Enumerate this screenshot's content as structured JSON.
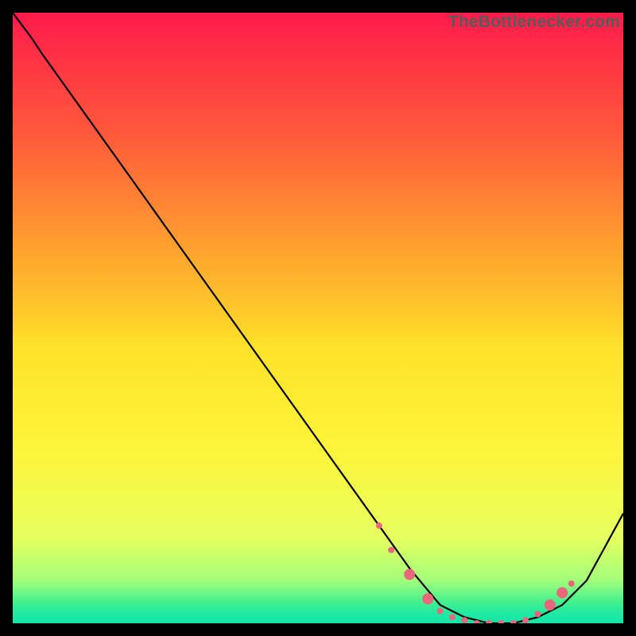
{
  "watermark": "TheBottlenecker.com",
  "chart_data": {
    "type": "line",
    "title": "",
    "xlabel": "",
    "ylabel": "",
    "xlim": [
      0,
      100
    ],
    "ylim": [
      0,
      100
    ],
    "grid": false,
    "legend": false,
    "background_gradient": {
      "stops": [
        {
          "pos": 0.0,
          "color": "#ff1a4b"
        },
        {
          "pos": 0.2,
          "color": "#ff5a3b"
        },
        {
          "pos": 0.4,
          "color": "#ffa62d"
        },
        {
          "pos": 0.55,
          "color": "#ffe22a"
        },
        {
          "pos": 0.72,
          "color": "#fdf53a"
        },
        {
          "pos": 0.86,
          "color": "#e6ff60"
        },
        {
          "pos": 0.93,
          "color": "#a2ff7a"
        },
        {
          "pos": 0.965,
          "color": "#44f08e"
        },
        {
          "pos": 0.985,
          "color": "#1de9a3"
        },
        {
          "pos": 1.0,
          "color": "#12e6a8"
        }
      ]
    },
    "series": [
      {
        "name": "bottleneck-curve",
        "color": "#000000",
        "x": [
          0,
          3,
          5,
          10,
          20,
          30,
          40,
          50,
          60,
          65,
          70,
          74,
          78,
          82,
          86,
          90,
          94,
          100
        ],
        "y": [
          100,
          96,
          93,
          86,
          72,
          58,
          44,
          30,
          16,
          9,
          3,
          1,
          0,
          0,
          1,
          3,
          7,
          18
        ]
      }
    ],
    "markers": {
      "name": "highlight-dots",
      "color": "#e9677a",
      "radius_small": 4,
      "radius_large": 7,
      "points": [
        {
          "x": 60,
          "y": 16,
          "r": "small"
        },
        {
          "x": 62,
          "y": 12,
          "r": "small"
        },
        {
          "x": 65,
          "y": 8,
          "r": "large"
        },
        {
          "x": 68,
          "y": 4,
          "r": "large"
        },
        {
          "x": 70,
          "y": 2,
          "r": "small"
        },
        {
          "x": 72,
          "y": 1,
          "r": "small"
        },
        {
          "x": 74,
          "y": 0.5,
          "r": "small"
        },
        {
          "x": 76,
          "y": 0,
          "r": "small"
        },
        {
          "x": 78,
          "y": 0,
          "r": "small"
        },
        {
          "x": 80,
          "y": 0,
          "r": "small"
        },
        {
          "x": 82,
          "y": 0,
          "r": "small"
        },
        {
          "x": 84,
          "y": 0.5,
          "r": "small"
        },
        {
          "x": 86,
          "y": 1.5,
          "r": "small"
        },
        {
          "x": 88,
          "y": 3,
          "r": "large"
        },
        {
          "x": 90,
          "y": 5,
          "r": "large"
        },
        {
          "x": 91.5,
          "y": 6.5,
          "r": "small"
        }
      ]
    }
  }
}
